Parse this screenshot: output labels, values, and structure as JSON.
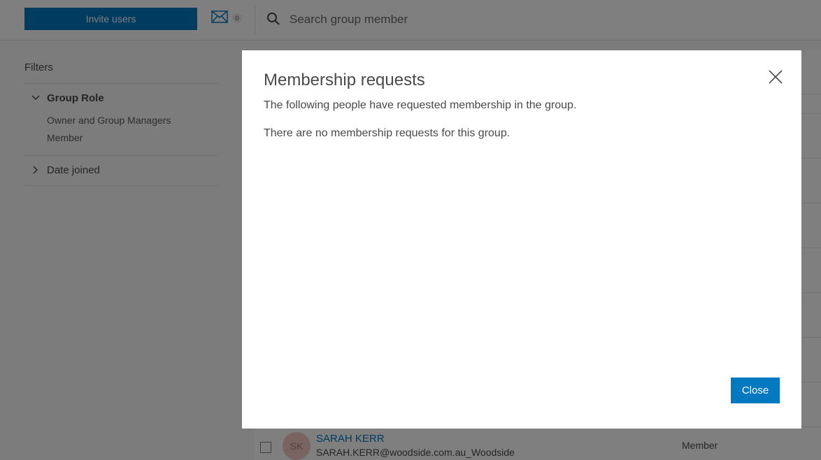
{
  "toolbar": {
    "invite_label": "Invite users",
    "message_count": "0",
    "search_placeholder": "Search group member"
  },
  "filters": {
    "title": "Filters",
    "groups": [
      {
        "label": "Group Role",
        "expanded": true,
        "options": [
          "Owner and Group Managers",
          "Member"
        ]
      },
      {
        "label": "Date joined",
        "expanded": false,
        "options": []
      }
    ]
  },
  "members": {
    "rows": [
      {
        "initials": "SK",
        "name": "SARAH KERR",
        "email": "SARAH.KERR@woodside.com.au_Woodside",
        "role": "Member"
      }
    ]
  },
  "modal": {
    "title": "Membership requests",
    "description": "The following people have requested membership in the group.",
    "empty_message": "There are no membership requests for this group.",
    "close_label": "Close"
  },
  "colors": {
    "accent": "#0079c1",
    "overlay": "rgba(0,0,0,0.5)",
    "avatar_bg": "#f2c9c4"
  },
  "icons": [
    "mail-icon",
    "search-icon",
    "chevron-down-icon",
    "chevron-right-icon",
    "close-icon"
  ]
}
